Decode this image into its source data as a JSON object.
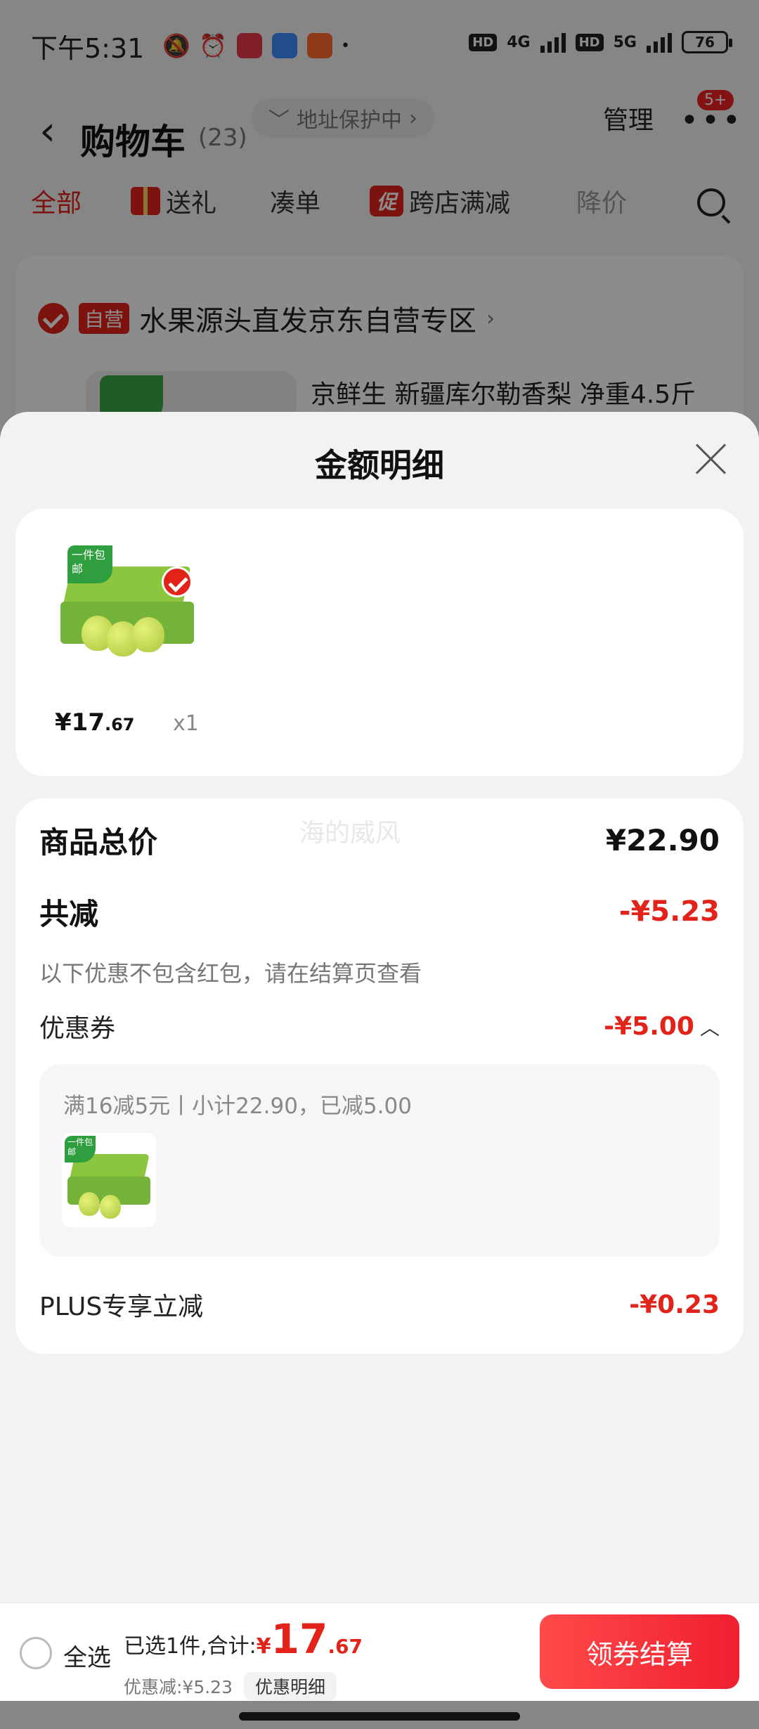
{
  "status_bar": {
    "time": "下午5:31",
    "net1": "4G",
    "net2": "5G",
    "hd": "HD",
    "battery": "76"
  },
  "nav": {
    "back_icon": "chevron-left-icon",
    "title": "购物车",
    "count": "(23)",
    "address_protect": "地址保护中",
    "manage": "管理",
    "badge": "5+"
  },
  "tabs": [
    {
      "label": "全部",
      "active": true
    },
    {
      "label": "送礼"
    },
    {
      "label": "凑单"
    },
    {
      "label": "跨店满减",
      "promo": "促"
    },
    {
      "label": "降价"
    }
  ],
  "store": {
    "tag": "自营",
    "name": "水果源头直发京东自营专区",
    "product_title": "京鲜生 新疆库尔勒香梨 净重4.5斤"
  },
  "sheet": {
    "title": "金额明细",
    "product": {
      "price_int": "¥17",
      "price_dec": ".67",
      "qty": "x1",
      "corner_tag": "一件包邮"
    },
    "watermark": "海的威风",
    "total_label": "商品总价",
    "total_value": "¥22.90",
    "reduce_label": "共减",
    "reduce_value": "-¥5.23",
    "note": "以下优惠不包含红包，请在结算页查看",
    "coupon_label": "优惠券",
    "coupon_value": "-¥5.00",
    "coupon_detail": "满16减5元丨小计22.90，已减5.00",
    "plus_label": "PLUS专享立减",
    "plus_value": "-¥0.23"
  },
  "bottom": {
    "select_all": "全选",
    "selected_text": "已选1件,合计:",
    "yen": "¥",
    "total_int": "17",
    "total_dec": ".67",
    "discount_text": "优惠减:¥5.23",
    "detail_btn": "优惠明细",
    "checkout": "领券结算"
  },
  "colors": {
    "accent": "#e2231a",
    "sheet_bg": "#f2f2f2"
  }
}
